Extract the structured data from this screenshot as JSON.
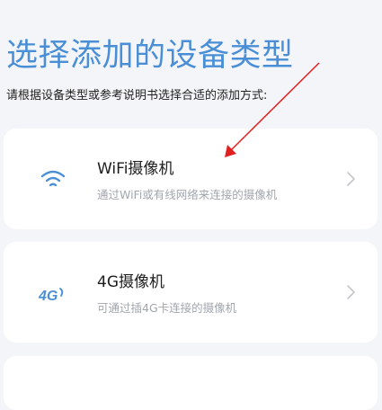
{
  "header": {
    "title": "选择添加的设备类型",
    "subtitle": "请根据设备类型或参考说明书选择合适的添加方式:"
  },
  "options": [
    {
      "icon": "wifi-icon",
      "title": "WiFi摄像机",
      "description": "通过WiFi或有线网络来连接的摄像机"
    },
    {
      "icon": "4g-icon",
      "icon_text": "4G",
      "title": "4G摄像机",
      "description": "可通过插4G卡连接的摄像机"
    }
  ],
  "colors": {
    "accent": "#4a8fd6",
    "annotation_arrow": "#e02020",
    "background": "#f4f5f8"
  }
}
